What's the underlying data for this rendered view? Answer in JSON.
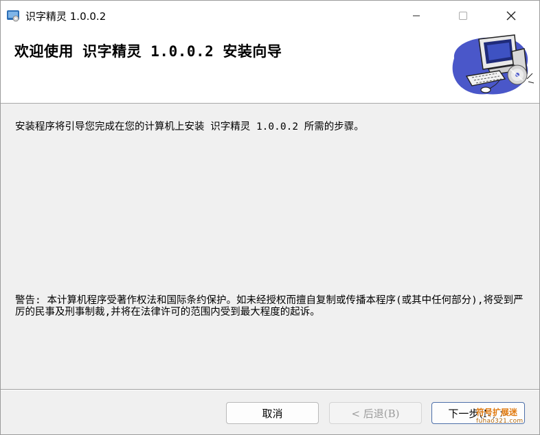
{
  "window": {
    "title": "识字精灵 1.0.0.2",
    "app_icon": "installer-icon",
    "controls": {
      "minimize_icon": "minimize-icon",
      "maximize_icon": "maximize-icon",
      "close_icon": "close-icon"
    }
  },
  "header": {
    "title": "欢迎使用 识字精灵 1.0.0.2 安装向导",
    "art_icon": "computer-installer-icon"
  },
  "body": {
    "intro": "安装程序将引导您完成在您的计算机上安装 识字精灵 1.0.0.2 所需的步骤。",
    "warning": "警告: 本计算机程序受著作权法和国际条约保护。如未经授权而擅自复制或传播本程序(或其中任何部分),将受到严厉的民事及刑事制裁,并将在法律许可的范围内受到最大程度的起诉。"
  },
  "buttons": {
    "cancel": "取消",
    "back": "< 后退(B)",
    "next": "下一步(N) >"
  },
  "watermark": {
    "text": "符号扩展迷",
    "url": "fuhao321.com"
  },
  "colors": {
    "window_bg": "#f0f0f0",
    "header_bg": "#ffffff",
    "default_button_border": "#4b6ea8",
    "disabled_text": "#9b9b9b"
  }
}
